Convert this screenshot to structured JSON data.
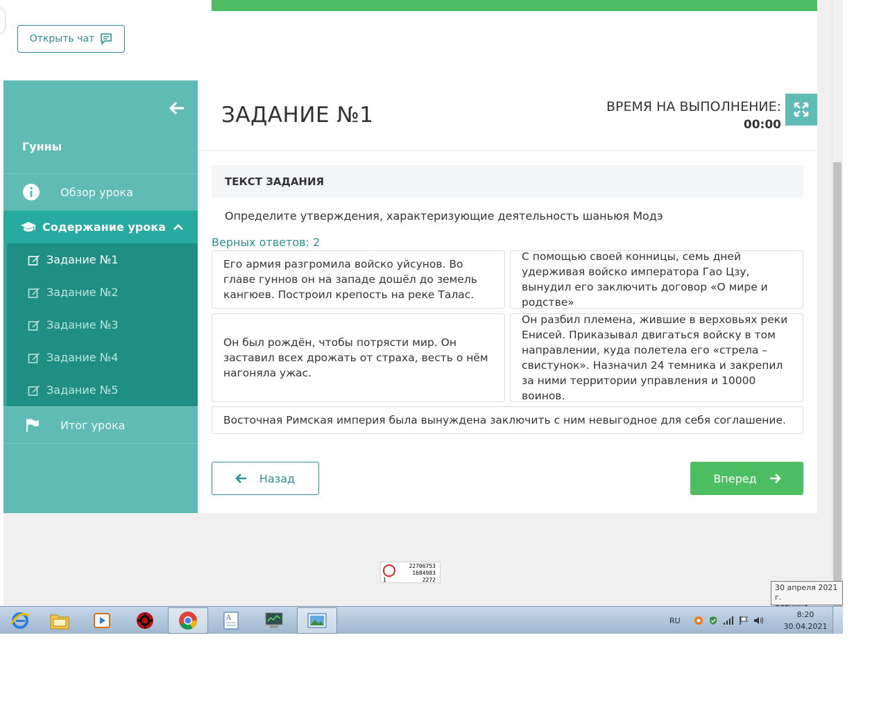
{
  "chat": {
    "label": "Открыть чат",
    "icon": "chat-icon"
  },
  "sidebar": {
    "course_title": "Гунны",
    "overview_label": "Обзор урока",
    "content_label": "Содержание урока",
    "tasks": [
      "Задание №1",
      "Задание №2",
      "Задание №3",
      "Задание №4",
      "Задание №5"
    ],
    "active_task_index": 0,
    "result_label": "Итог урока",
    "accent": "#5fbcb4",
    "active_bg": "#27aba0"
  },
  "main": {
    "title": "ЗАДАНИЕ №1",
    "timer_label": "ВРЕМЯ НА ВЫПОЛНЕНИЕ:",
    "timer_value": "00:00",
    "task_heading": "ТЕКСТ ЗАДАНИЯ",
    "question": "Определите утверждения, характеризующие деятельность шаньюя Модэ",
    "correct_count": "Верных ответов: 2",
    "answers": [
      "Его армия разгромила войско уйсунов. Во главе гуннов он на западе дошёл до земель кангюев. Построил крепость на реке Талас.",
      "С помощью своей конницы, семь дней удерживая войско императора Гао Цзу, вынудил его заключить договор «О мире и родстве»",
      "Он был рождён, чтобы потрясти мир. Он заставил всех дрожать от страха, весть о нём нагоняла ужас.",
      "Он разбил племена, жившие в верховьях реки Енисей. Приказывал двигаться войску в том направлении, куда полетела его «стрела – свистунок». Назначил 24 темника и закрепил за ними территории управления и 10000 воинов.",
      "Восточная Римская империя была вынуждена заключить с ним невыгодное для себя соглашение."
    ],
    "back_label": "Назад",
    "next_label": "Вперед",
    "next_color": "#4dbe62"
  },
  "counter": {
    "line1": "22706753",
    "line2": "1684983",
    "line3": "2272",
    "left": "1"
  },
  "tooltip": {
    "date": "30 апреля 2021 г.",
    "weekday": "пятница"
  },
  "taskbar": {
    "apps": [
      "ie-icon",
      "explorer-icon",
      "media-player-icon",
      "antivirus-icon",
      "chrome-icon",
      "wordpad-icon",
      "monitor-icon",
      "photos-icon"
    ],
    "lang": "RU",
    "time": "8:20",
    "date": "30.04.2021"
  }
}
